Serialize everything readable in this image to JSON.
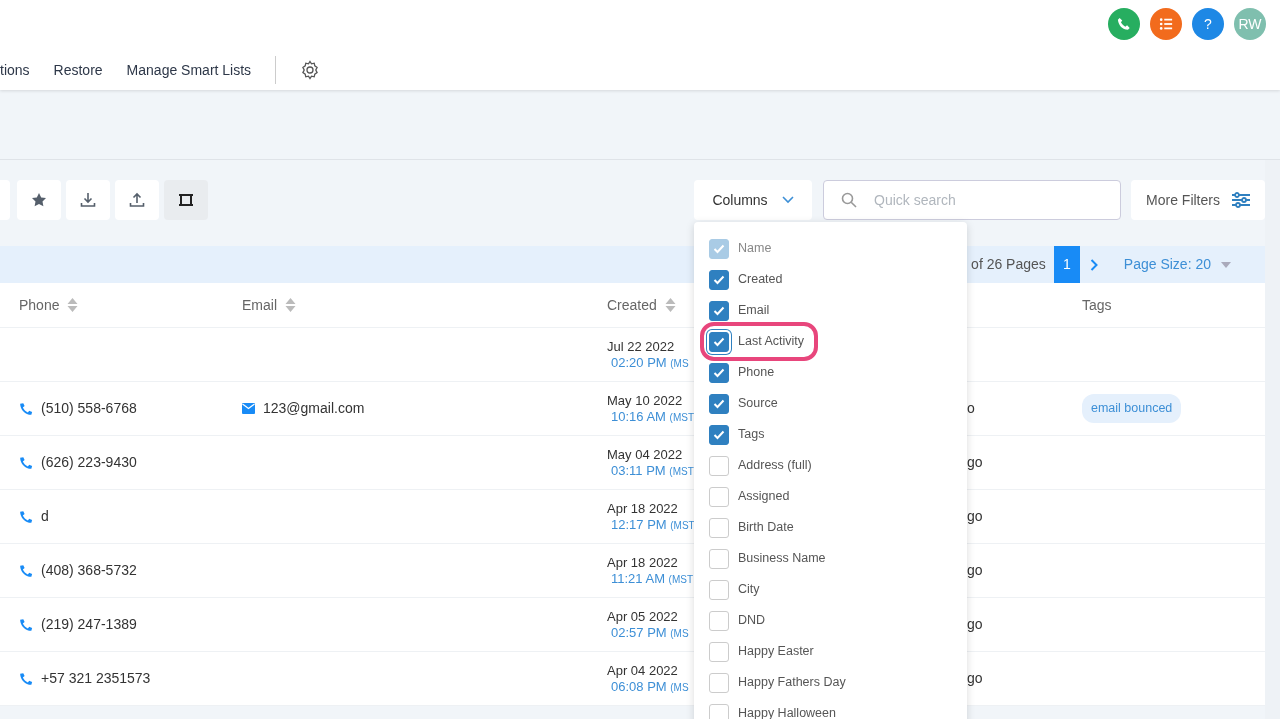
{
  "nav": [
    "tions",
    "Restore",
    "Manage Smart Lists"
  ],
  "header_icons": [
    {
      "kind": "phone",
      "color": "#27ae60"
    },
    {
      "kind": "list",
      "color": "#f26b1d"
    },
    {
      "kind": "help",
      "label": "?",
      "color": "#1e88e5"
    },
    {
      "kind": "avatar",
      "label": "RW",
      "color": "#7fbfae"
    }
  ],
  "toolbar": [
    {
      "kind": "partial",
      "selected": false
    },
    {
      "kind": "star",
      "selected": false
    },
    {
      "kind": "download",
      "selected": false
    },
    {
      "kind": "upload",
      "selected": false
    },
    {
      "kind": "crop",
      "selected": true
    }
  ],
  "columns_button": {
    "label": "Columns"
  },
  "search": {
    "placeholder": "Quick search"
  },
  "more_filters": {
    "label": "More Filters"
  },
  "pagination": {
    "pages_text": "of 26 Pages",
    "current_page": "1",
    "page_size": "Page Size: 20"
  },
  "table": {
    "columns": [
      "Phone",
      "Email",
      "Created",
      "Tags"
    ],
    "rows": [
      {
        "phone": "",
        "email": "",
        "date": "Jul 22 2022",
        "time": "02:20 PM",
        "tz": "(MS",
        "activity": "",
        "tags": []
      },
      {
        "phone": "(510) 558-6768",
        "email": "123@gmail.com",
        "date": "May 10 2022",
        "time": "10:16 AM",
        "tz": "(MST",
        "activity": "o",
        "tags": [
          "email bounced"
        ]
      },
      {
        "phone": "(626) 223-9430",
        "email": "",
        "date": "May 04 2022",
        "time": "03:11 PM",
        "tz": "(MST",
        "activity": "go",
        "tags": []
      },
      {
        "phone": "d",
        "email": "",
        "date": "Apr 18 2022",
        "time": "12:17 PM",
        "tz": "(MST",
        "activity": "go",
        "tags": []
      },
      {
        "phone": "(408) 368-5732",
        "email": "",
        "date": "Apr 18 2022",
        "time": "11:21 AM",
        "tz": "(MST",
        "activity": "go",
        "tags": []
      },
      {
        "phone": "(219) 247-1389",
        "email": "",
        "date": "Apr 05 2022",
        "time": "02:57 PM",
        "tz": "(MS",
        "activity": "go",
        "tags": []
      },
      {
        "phone": "+57 321 2351573",
        "email": "",
        "date": "Apr 04 2022",
        "time": "06:08 PM",
        "tz": "(MS",
        "activity": "go",
        "tags": []
      }
    ]
  },
  "columns_menu": [
    {
      "label": "Name",
      "checked": true,
      "disabled": true,
      "highlighted": false
    },
    {
      "label": "Created",
      "checked": true,
      "disabled": false,
      "highlighted": false
    },
    {
      "label": "Email",
      "checked": true,
      "disabled": false,
      "highlighted": false
    },
    {
      "label": "Last Activity",
      "checked": true,
      "disabled": false,
      "highlighted": true
    },
    {
      "label": "Phone",
      "checked": true,
      "disabled": false,
      "highlighted": false
    },
    {
      "label": "Source",
      "checked": true,
      "disabled": false,
      "highlighted": false
    },
    {
      "label": "Tags",
      "checked": true,
      "disabled": false,
      "highlighted": false
    },
    {
      "label": "Address (full)",
      "checked": false,
      "disabled": false,
      "highlighted": false
    },
    {
      "label": "Assigned",
      "checked": false,
      "disabled": false,
      "highlighted": false
    },
    {
      "label": "Birth Date",
      "checked": false,
      "disabled": false,
      "highlighted": false
    },
    {
      "label": "Business Name",
      "checked": false,
      "disabled": false,
      "highlighted": false
    },
    {
      "label": "City",
      "checked": false,
      "disabled": false,
      "highlighted": false
    },
    {
      "label": "DND",
      "checked": false,
      "disabled": false,
      "highlighted": false
    },
    {
      "label": "Happy Easter",
      "checked": false,
      "disabled": false,
      "highlighted": false
    },
    {
      "label": "Happy Fathers Day",
      "checked": false,
      "disabled": false,
      "highlighted": false
    },
    {
      "label": "Happy Halloween",
      "checked": false,
      "disabled": false,
      "highlighted": false
    }
  ]
}
